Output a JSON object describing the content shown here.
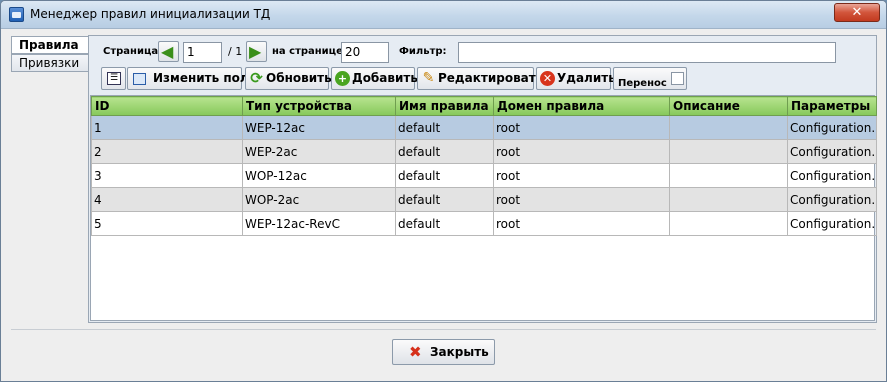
{
  "window": {
    "title": "Менеджер правил инициализации ТД",
    "close_glyph": "✕"
  },
  "tabs": [
    {
      "label": "Правила"
    },
    {
      "label": "Привязки"
    }
  ],
  "pager": {
    "page_label": "Страница:",
    "page_value": "1",
    "page_total": "/ 1",
    "per_page_label": "на странице:",
    "per_page_value": "20",
    "filter_label": "Фильтр:",
    "filter_value": ""
  },
  "toolbar": {
    "edit_fields": "Изменить поля",
    "refresh": "Обновить",
    "add": "Добавить",
    "edit": "Редактировать",
    "delete": "Удалить",
    "wrap_label": "Перенос"
  },
  "table": {
    "columns": [
      "ID",
      "Тип устройства",
      "Имя правила",
      "Домен правила",
      "Описание",
      "Параметры"
    ],
    "rows": [
      [
        "1",
        "WEP-12ac",
        "default",
        "root",
        "",
        "Configuration..."
      ],
      [
        "2",
        "WEP-2ac",
        "default",
        "root",
        "",
        "Configuration..."
      ],
      [
        "3",
        "WOP-12ac",
        "default",
        "root",
        "",
        "Configuration..."
      ],
      [
        "4",
        "WOP-2ac",
        "default",
        "root",
        "",
        "Configuration..."
      ],
      [
        "5",
        "WEP-12ac-RevC",
        "default",
        "root",
        "",
        "Configuration..."
      ]
    ]
  },
  "footer": {
    "close_label": "Закрыть"
  }
}
